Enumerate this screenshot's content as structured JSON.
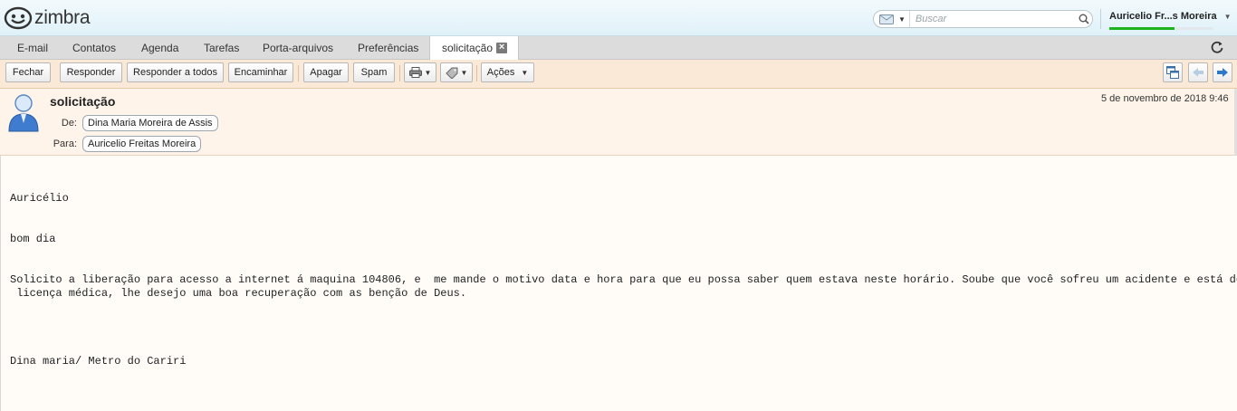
{
  "header": {
    "logo_text": "zimbra",
    "search_placeholder": "Buscar",
    "user_name": "Auricelio Fr...s Moreira"
  },
  "apptabs": {
    "email": "E-mail",
    "contacts": "Contatos",
    "agenda": "Agenda",
    "tasks": "Tarefas",
    "briefcase": "Porta-arquivos",
    "preferences": "Preferências",
    "active_tab": "solicitação"
  },
  "toolbar": {
    "close": "Fechar",
    "reply": "Responder",
    "reply_all": "Responder a todos",
    "forward": "Encaminhar",
    "delete": "Apagar",
    "spam": "Spam",
    "actions": "Ações"
  },
  "message": {
    "subject": "solicitação",
    "date": "5 de novembro de 2018 9:46",
    "from_label": "De:",
    "from": "Dina Maria Moreira de Assis",
    "to_label": "Para:",
    "to": "Auricelio Freitas Moreira",
    "body": {
      "greeting": "Auricélio",
      "salutation": "bom dia",
      "paragraph_line1": "Solicito a liberação para acesso a internet á maquina 104806, e  me mande o motivo data e hora para que eu possa saber quem estava neste horário. Soube que você sofreu um acidente e está de",
      "paragraph_line2": " licença médica, lhe desejo uma boa recuperação com as benção de Deus.",
      "signature": "Dina maria/ Metro do Cariri"
    }
  },
  "colors": {
    "active_user_bar": "#1db31d",
    "toolbar_bg": "#fbe9d7",
    "header_bg": "#fef4ea"
  }
}
